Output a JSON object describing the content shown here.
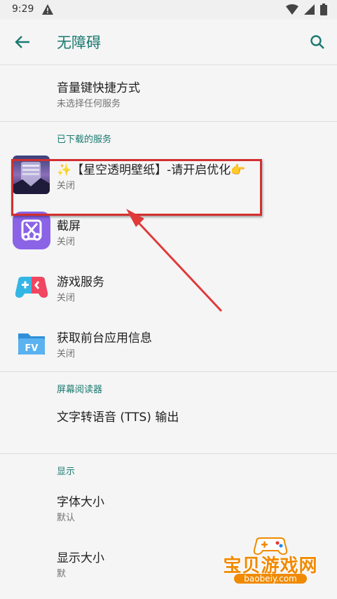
{
  "status_bar": {
    "time": "9:29"
  },
  "app_bar": {
    "title": "无障碍"
  },
  "shortcut": {
    "title": "音量键快捷方式",
    "subtitle": "未选择任何服务"
  },
  "downloaded_section": {
    "header": "已下载的服务",
    "items": [
      {
        "title": "✨【星空透明壁纸】-请开启优化👉",
        "subtitle": "关闭"
      },
      {
        "title": "截屏",
        "subtitle": "关闭"
      },
      {
        "title": "游戏服务",
        "subtitle": "关闭"
      },
      {
        "title": "获取前台应用信息",
        "subtitle": "关闭"
      }
    ]
  },
  "screen_reader_section": {
    "header": "屏幕阅读器",
    "items": [
      {
        "title": "文字转语音 (TTS) 输出"
      }
    ]
  },
  "display_section": {
    "header": "显示",
    "items": [
      {
        "title": "字体大小",
        "subtitle": "默认"
      },
      {
        "title": "显示大小",
        "subtitle": "默"
      }
    ]
  },
  "watermark": {
    "name": "宝贝游戏网",
    "url": "baobeiy.com"
  },
  "colors": {
    "accent": "#1a7a70",
    "highlight": "#d32f2f",
    "watermark": "#f08a00"
  }
}
